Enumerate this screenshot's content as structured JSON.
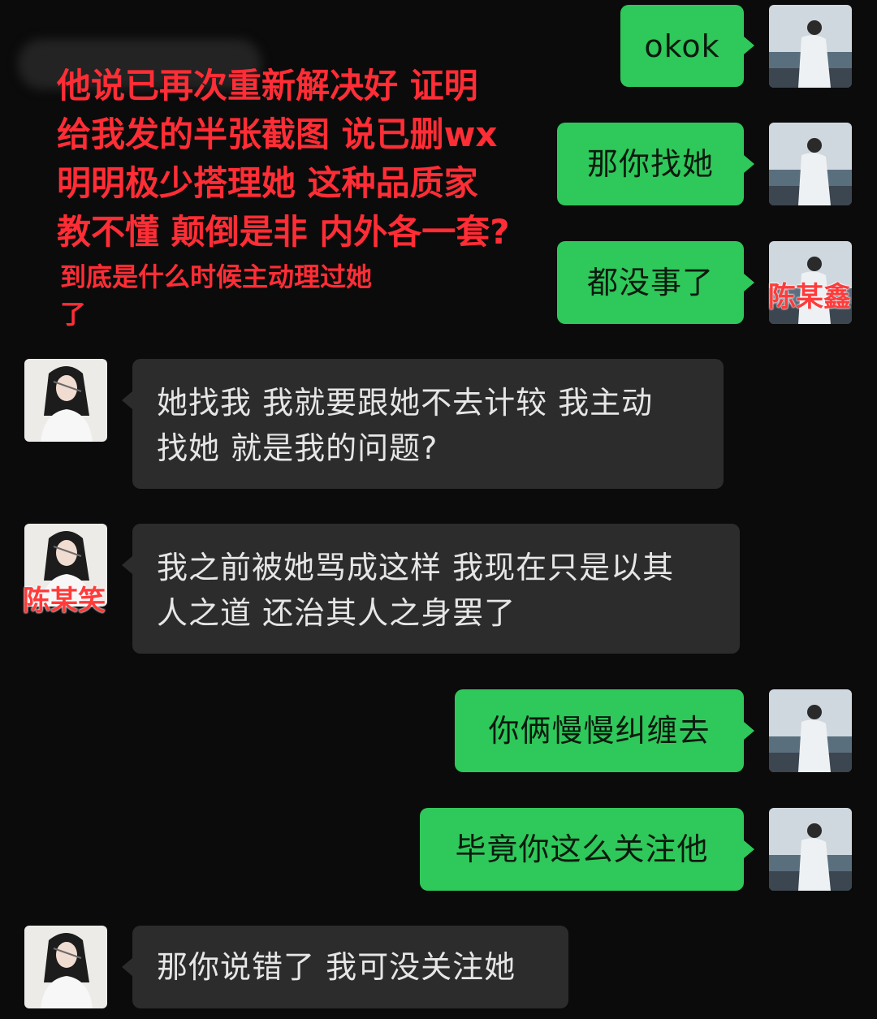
{
  "annotation": {
    "lines": [
      "他说已再次重新解决好 证明",
      "给我发的半张截图 说已删wx",
      "明明极少搭理她 这种品质家",
      "教不懂 颠倒是非 内外各一套?"
    ],
    "sub_lines": [
      "到底是什么时候主动理过她",
      "了"
    ]
  },
  "labels": {
    "right_user": "陈某鑫",
    "left_user": "陈某笑"
  },
  "messages": [
    {
      "side": "right",
      "text": "okok"
    },
    {
      "side": "right",
      "text": "那你找她"
    },
    {
      "side": "right",
      "text": "都没事了"
    },
    {
      "side": "left",
      "lines": [
        "她找我 我就要跟她不去计较  我主动",
        "找她 就是我的问题?"
      ]
    },
    {
      "side": "left",
      "lines": [
        "我之前被她骂成这样 我现在只是以其",
        "人之道 还治其人之身罢了"
      ]
    },
    {
      "side": "right",
      "text": "你俩慢慢纠缠去"
    },
    {
      "side": "right",
      "text": "毕竟你这么关注他"
    },
    {
      "side": "left",
      "lines": [
        "那你说错了 我可没关注她"
      ]
    }
  ],
  "colors": {
    "background": "#0b0b0b",
    "out_bubble": "#2fc85a",
    "in_bubble": "#2c2c2c",
    "annotation_red": "#ff2d35"
  }
}
